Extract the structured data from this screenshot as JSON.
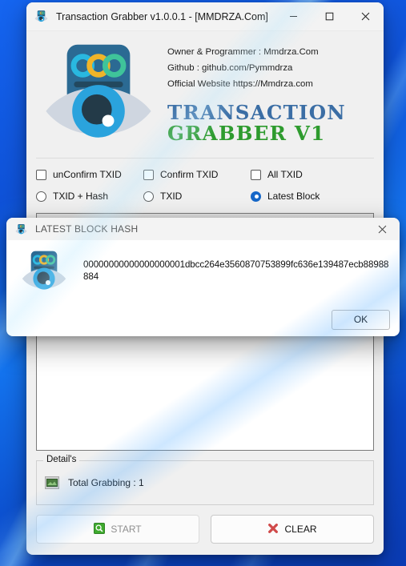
{
  "window": {
    "title": "Transaction Grabber v1.0.0.1 - [MMDRZA.Com]",
    "app_icon": "eye-logo-icon",
    "minimize_label": "—",
    "maximize_label": "☐",
    "close_label": "✕"
  },
  "brand": {
    "logo_icon": "eye-logo-icon",
    "info_lines": [
      "Owner & Programmer : Mmdrza.Com",
      "Github : github.com/Pymmdrza",
      "Official Website https://Mmdrza.com"
    ],
    "title_line1": "TRANSACTION",
    "title_line2": "GRABBER V1",
    "color_line1": "#3b6ea5",
    "color_line2": "#2e9b2e"
  },
  "checkboxes": [
    {
      "label": "unConfirm TXID",
      "checked": false
    },
    {
      "label": "Confirm TXID",
      "checked": false
    },
    {
      "label": "All TXID",
      "checked": false
    }
  ],
  "radios": [
    {
      "label": "TXID + Hash",
      "checked": false
    },
    {
      "label": "TXID",
      "checked": false
    },
    {
      "label": "Latest Block",
      "checked": true
    }
  ],
  "output": {
    "value": "",
    "placeholder": ""
  },
  "details": {
    "legend": "Detail's",
    "icon": "green-card-icon",
    "status_text": "Total Grabbing : 1"
  },
  "buttons": {
    "start": {
      "label": "START",
      "icon": "green-magnifier-icon",
      "disabled": true
    },
    "clear": {
      "label": "CLEAR",
      "icon": "red-cross-icon",
      "disabled": false
    }
  },
  "dialog": {
    "title": "LATEST BLOCK HASH",
    "icon": "eye-logo-icon",
    "close_label": "✕",
    "hash": "00000000000000000001dbcc264e3560870753899fc636e139487ecb88988884",
    "ok_label": "OK"
  }
}
